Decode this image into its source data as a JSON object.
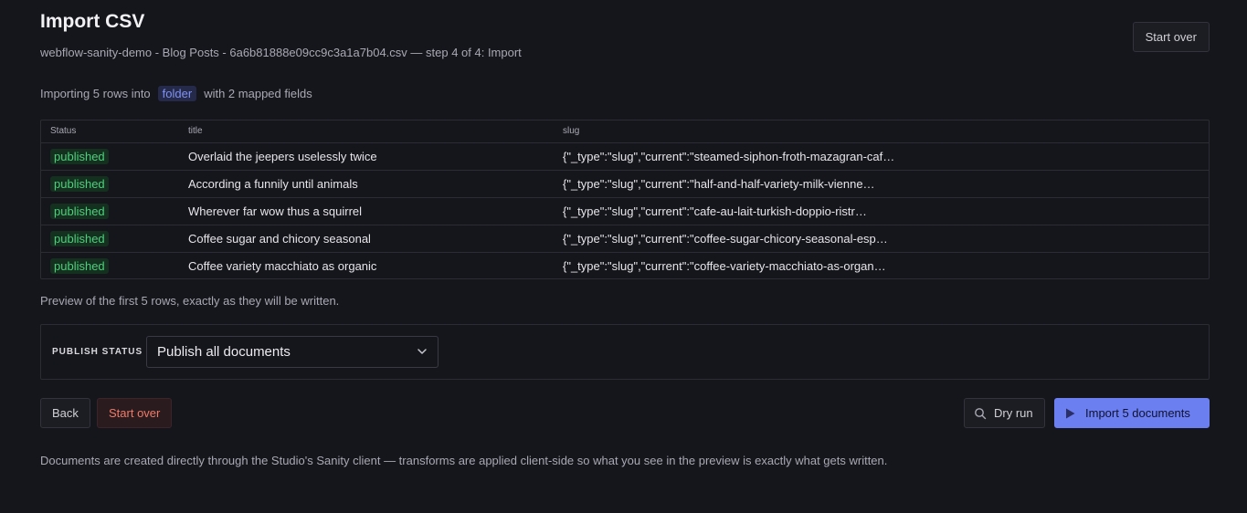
{
  "header": {
    "title": "Import CSV",
    "subtitle": "webflow-sanity-demo - Blog Posts - 6a6b81888e09cc9c3a1a7b04.csv — step 4 of 4: Import",
    "start_over_label": "Start over"
  },
  "summary": {
    "prefix": "Importing 5 rows into",
    "type_pill": "folder",
    "suffix": "with 2 mapped fields"
  },
  "table": {
    "columns": [
      "Status",
      "title",
      "slug"
    ],
    "rows": [
      {
        "status": "published",
        "title": "Overlaid the jeepers uselessly twice",
        "slug": "{\"_type\":\"slug\",\"current\":\"steamed-siphon-froth-mazagran-caf…"
      },
      {
        "status": "published",
        "title": "According a funnily until animals",
        "slug": "{\"_type\":\"slug\",\"current\":\"half-and-half-variety-milk-vienne…"
      },
      {
        "status": "published",
        "title": "Wherever far wow thus a squirrel",
        "slug": "{\"_type\":\"slug\",\"current\":\"cafe-au-lait-turkish-doppio-ristr…"
      },
      {
        "status": "published",
        "title": "Coffee sugar and chicory seasonal",
        "slug": "{\"_type\":\"slug\",\"current\":\"coffee-sugar-chicory-seasonal-esp…"
      },
      {
        "status": "published",
        "title": "Coffee variety macchiato as organic",
        "slug": "{\"_type\":\"slug\",\"current\":\"coffee-variety-macchiato-as-organ…"
      }
    ]
  },
  "preview_note": "Preview of the first 5 rows, exactly as they will be written.",
  "publish": {
    "label": "PUBLISH STATUS",
    "selected": "Publish all documents"
  },
  "actions": {
    "back": "Back",
    "start_over": "Start over",
    "dry_run": "Dry run",
    "import": "Import 5 documents"
  },
  "footer_note": "Documents are created directly through the Studio's Sanity client — transforms are applied client-side so what you see in the preview is exactly what gets written.",
  "colors": {
    "background": "#15151c",
    "accent": "#6c7ff0",
    "published_green": "#4fcf7c",
    "danger": "#f07a68"
  },
  "icons": {
    "select": "chevron-down-icon",
    "dry_run": "search-icon",
    "import": "play-icon"
  }
}
